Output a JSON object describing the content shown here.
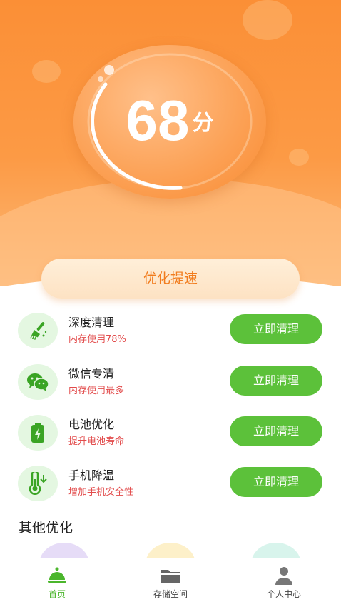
{
  "score": {
    "value": "68",
    "unit": "分"
  },
  "optimize_button": "优化提速",
  "items": [
    {
      "title": "深度清理",
      "subtitle": "内存使用78%",
      "button": "立即清理",
      "icon": "broom-icon"
    },
    {
      "title": "微信专清",
      "subtitle": "内存使用最多",
      "button": "立即清理",
      "icon": "wechat-icon"
    },
    {
      "title": "电池优化",
      "subtitle": "提升电池寿命",
      "button": "立即清理",
      "icon": "battery-icon"
    },
    {
      "title": "手机降温",
      "subtitle": "增加手机安全性",
      "button": "立即清理",
      "icon": "thermometer-icon"
    }
  ],
  "other_section_title": "其他优化",
  "tabs": [
    {
      "label": "首页",
      "icon": "home-bell-icon",
      "active": true
    },
    {
      "label": "存储空间",
      "icon": "folder-icon",
      "active": false
    },
    {
      "label": "个人中心",
      "icon": "person-icon",
      "active": false
    }
  ],
  "colors": {
    "orange": "#fb8f36",
    "green": "#5cc13a",
    "red_text": "#e24b4b",
    "active_tab": "#4bb62c"
  }
}
